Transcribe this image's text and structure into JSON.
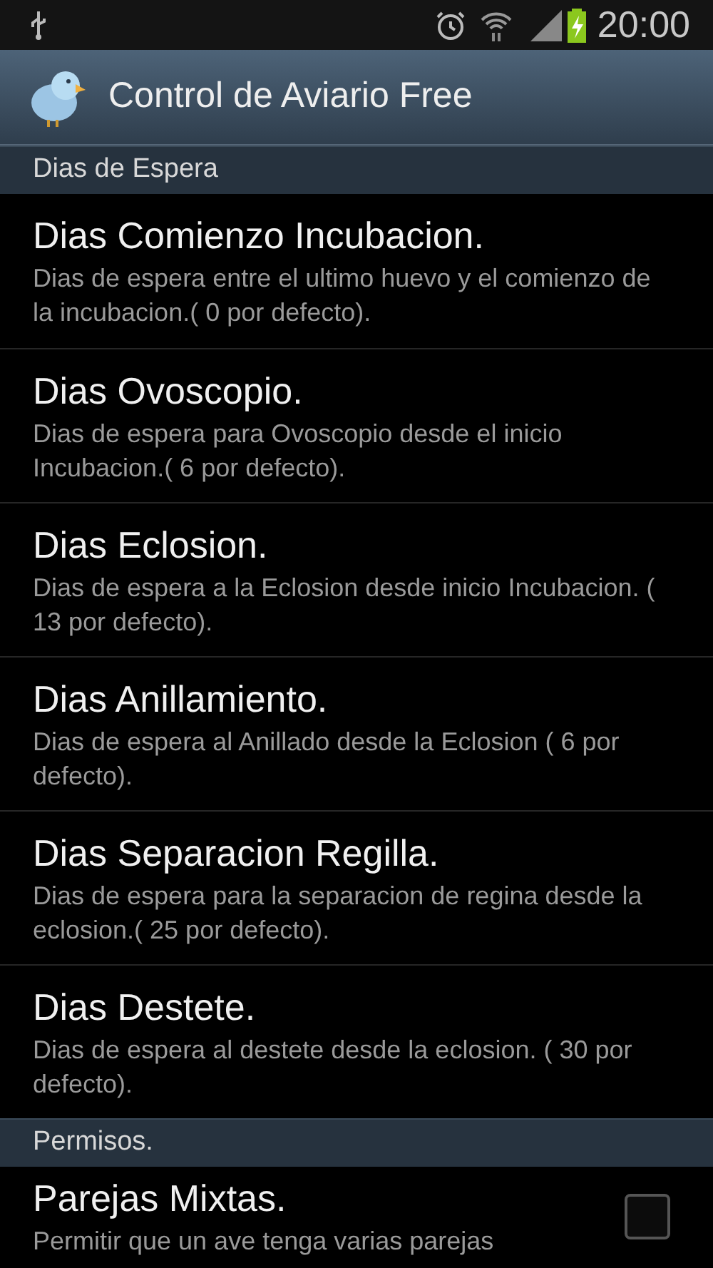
{
  "status_bar": {
    "time": "20:00"
  },
  "action_bar": {
    "title": "Control de Aviario Free"
  },
  "sections": [
    {
      "header": "Dias de Espera",
      "items": [
        {
          "kind": "text",
          "title": "Dias Comienzo Incubacion.",
          "summary": "Dias de espera entre el ultimo huevo y el comienzo de la incubacion.( 0 por defecto)."
        },
        {
          "kind": "text",
          "title": "Dias Ovoscopio.",
          "summary": "Dias de espera para Ovoscopio desde el inicio Incubacion.( 6 por defecto)."
        },
        {
          "kind": "text",
          "title": "Dias Eclosion.",
          "summary": "Dias de espera a la Eclosion desde inicio Incubacion. ( 13 por defecto)."
        },
        {
          "kind": "text",
          "title": "Dias Anillamiento.",
          "summary": "Dias de espera al Anillado desde la Eclosion ( 6 por defecto)."
        },
        {
          "kind": "text",
          "title": "Dias Separacion Regilla.",
          "summary": "Dias de espera para la separacion de regina desde la eclosion.( 25 por defecto)."
        },
        {
          "kind": "text",
          "title": "Dias Destete.",
          "summary": "Dias de espera al destete desde la eclosion. ( 30 por defecto)."
        }
      ]
    },
    {
      "header": "Permisos.",
      "items": [
        {
          "kind": "checkbox",
          "title": "Parejas Mixtas.",
          "summary": "Permitir que un ave tenga varias parejas",
          "checked": false
        }
      ]
    }
  ]
}
